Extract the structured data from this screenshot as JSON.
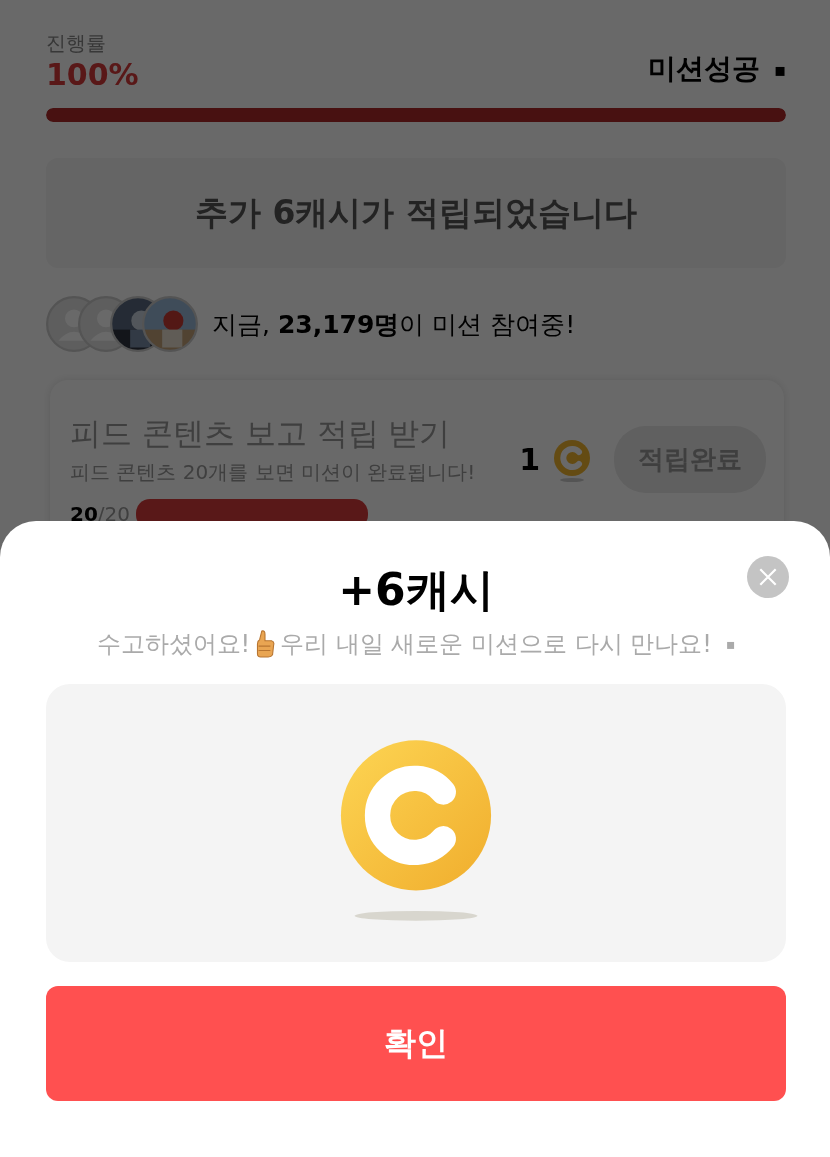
{
  "progress": {
    "label": "진행률",
    "value": "100%",
    "status": "미션성공",
    "status_mark": "▪",
    "level": 1
  },
  "banner": {
    "text": "추가 6캐시가 적립되었습니다"
  },
  "participants": {
    "avatars": [
      {
        "kind": "silhouette"
      },
      {
        "kind": "silhouette"
      },
      {
        "kind": "picture"
      },
      {
        "kind": "picture"
      }
    ],
    "text": "지금, **23,179명**이 미션 참여중!"
  },
  "mission": {
    "title": "피드 콘텐츠 보고 적립 받기",
    "description": "피드 콘텐츠 20개를 보면 미션이 완료됩니다!",
    "reward": "1",
    "button": {
      "label": "적립완료",
      "disabled": true
    },
    "count": "**20**/20",
    "level": 1
  },
  "sheet": {
    "title": "+6캐시",
    "message_before": "수고하셨어요!",
    "message_after": "우리 내일 새로운 미션으로 다시 만나요!",
    "message_mark": "▪",
    "confirm": "확인"
  }
}
